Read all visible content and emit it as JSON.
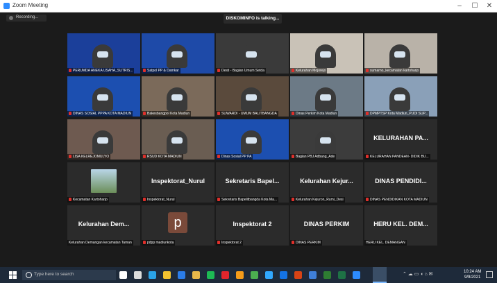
{
  "window": {
    "title": "Zoom Meeting",
    "min_label": "–",
    "max_label": "☐",
    "close_label": "✕"
  },
  "recording": {
    "label": "Recording..."
  },
  "talking_banner": "DISKOMINFO is talking...",
  "tiles": [
    {
      "name": "PERUMDA ANEKA USAHA_SUTRIS...",
      "type": "video",
      "bg": "#1b3f9a"
    },
    {
      "name": "Satpol PP & Damkar",
      "type": "video",
      "bg": "#1e4aa8"
    },
    {
      "name": "Desti - Bagian Umum Setda",
      "type": "video",
      "bg": "#3a3a3a"
    },
    {
      "name": "Kelurahan Mojorejo",
      "type": "video",
      "bg": "#c9c2b7"
    },
    {
      "name": "sumarno_kecamatan kartoharjo",
      "type": "video",
      "bg": "#b9b2a8"
    },
    {
      "name": "DINAS SOSIAL PPPA KOTA MADIUN",
      "type": "video",
      "bg": "#1c4fb0"
    },
    {
      "name": "Bakesbangpol Kota Madiun",
      "type": "video",
      "bg": "#7b6a5a"
    },
    {
      "name": "SUWARDI - UMUM BALITBANGDA",
      "type": "video",
      "bg": "#5a4a3c"
    },
    {
      "name": "Dinas Perkim Kota Madiun",
      "type": "video",
      "bg": "#6c7a86"
    },
    {
      "name": "DPMPTSP Kota Madiun_PUDI SUP...",
      "type": "video",
      "bg": "#8aa0b8"
    },
    {
      "name": "LISA KELREJOMULYO",
      "type": "video",
      "bg": "#6e5a50"
    },
    {
      "name": "RSUD KOTA MADIUN",
      "type": "video",
      "bg": "#6a5d52"
    },
    {
      "name": "Dinas Sosial PP PA",
      "type": "video",
      "bg": "#1c4fb0"
    },
    {
      "name": "Bagian PBJ Adbang_Ade",
      "type": "video",
      "bg": "#3c3c3c"
    },
    {
      "name": "KELURAHAN PANDEAN- DIDIK BU...",
      "type": "text",
      "big": "KELURAHAN PA..."
    },
    {
      "name": "Kecamatan Kartoharjo",
      "type": "image",
      "bg": "#2b2b2b"
    },
    {
      "name": "Inspektorat_Nurul",
      "type": "text",
      "big": "Inspektorat_Nurul"
    },
    {
      "name": "Sekretaris Bapelitbangda Kota Ma...",
      "type": "text",
      "big": "Sekretaris Bapel..."
    },
    {
      "name": "Kelurahan Kejuron_Rumi_Desi",
      "type": "text",
      "big": "Kelurahan Kejur..."
    },
    {
      "name": "DINAS PENDIDIKAN KOTA MADIUN",
      "type": "text",
      "big": "DINAS PENDIDI..."
    },
    {
      "name": "Kelurahan Demangan kecamatan Taman",
      "type": "text",
      "big": "Kelurahan Dem...",
      "nomic": true
    },
    {
      "name": "pdpp madiunkota",
      "type": "avatar",
      "big": "p"
    },
    {
      "name": "Inspektorat 2",
      "type": "text",
      "big": "Inspektorat 2"
    },
    {
      "name": "DINAS PERKIM",
      "type": "text",
      "big": "DINAS PERKIM"
    },
    {
      "name": "HERU KEL. DEMANGAN",
      "type": "text",
      "big": "HERU KEL. DEM...",
      "nomic": true
    }
  ],
  "taskbar": {
    "search_placeholder": "Type here to search",
    "time": "10:24 AM",
    "date": "9/9/2021",
    "app_icons": [
      {
        "name": "microphone-icon",
        "color": "#ffffff"
      },
      {
        "name": "task-view-icon",
        "color": "#dcdcdc"
      },
      {
        "name": "edge-icon",
        "color": "#2aa3e8"
      },
      {
        "name": "store-icon",
        "color": "#f2c230"
      },
      {
        "name": "mail-icon",
        "color": "#2b7de9"
      },
      {
        "name": "explorer-icon",
        "color": "#e8b84a"
      },
      {
        "name": "spotify-icon",
        "color": "#1db954"
      },
      {
        "name": "opera-icon",
        "color": "#e2252c"
      },
      {
        "name": "illustrator-icon",
        "color": "#f59c1a"
      },
      {
        "name": "chrome-icon",
        "color": "#4caf50"
      },
      {
        "name": "lightroom-icon",
        "color": "#31a8ff"
      },
      {
        "name": "photoshop-icon",
        "color": "#1473e6"
      },
      {
        "name": "app-red-icon",
        "color": "#d84315"
      },
      {
        "name": "app-blue-icon",
        "color": "#3f7fd9"
      },
      {
        "name": "app-green-icon",
        "color": "#2e7d32"
      },
      {
        "name": "excel-icon",
        "color": "#1e7145"
      },
      {
        "name": "zoom-icon",
        "color": "#2d8cff"
      }
    ]
  }
}
